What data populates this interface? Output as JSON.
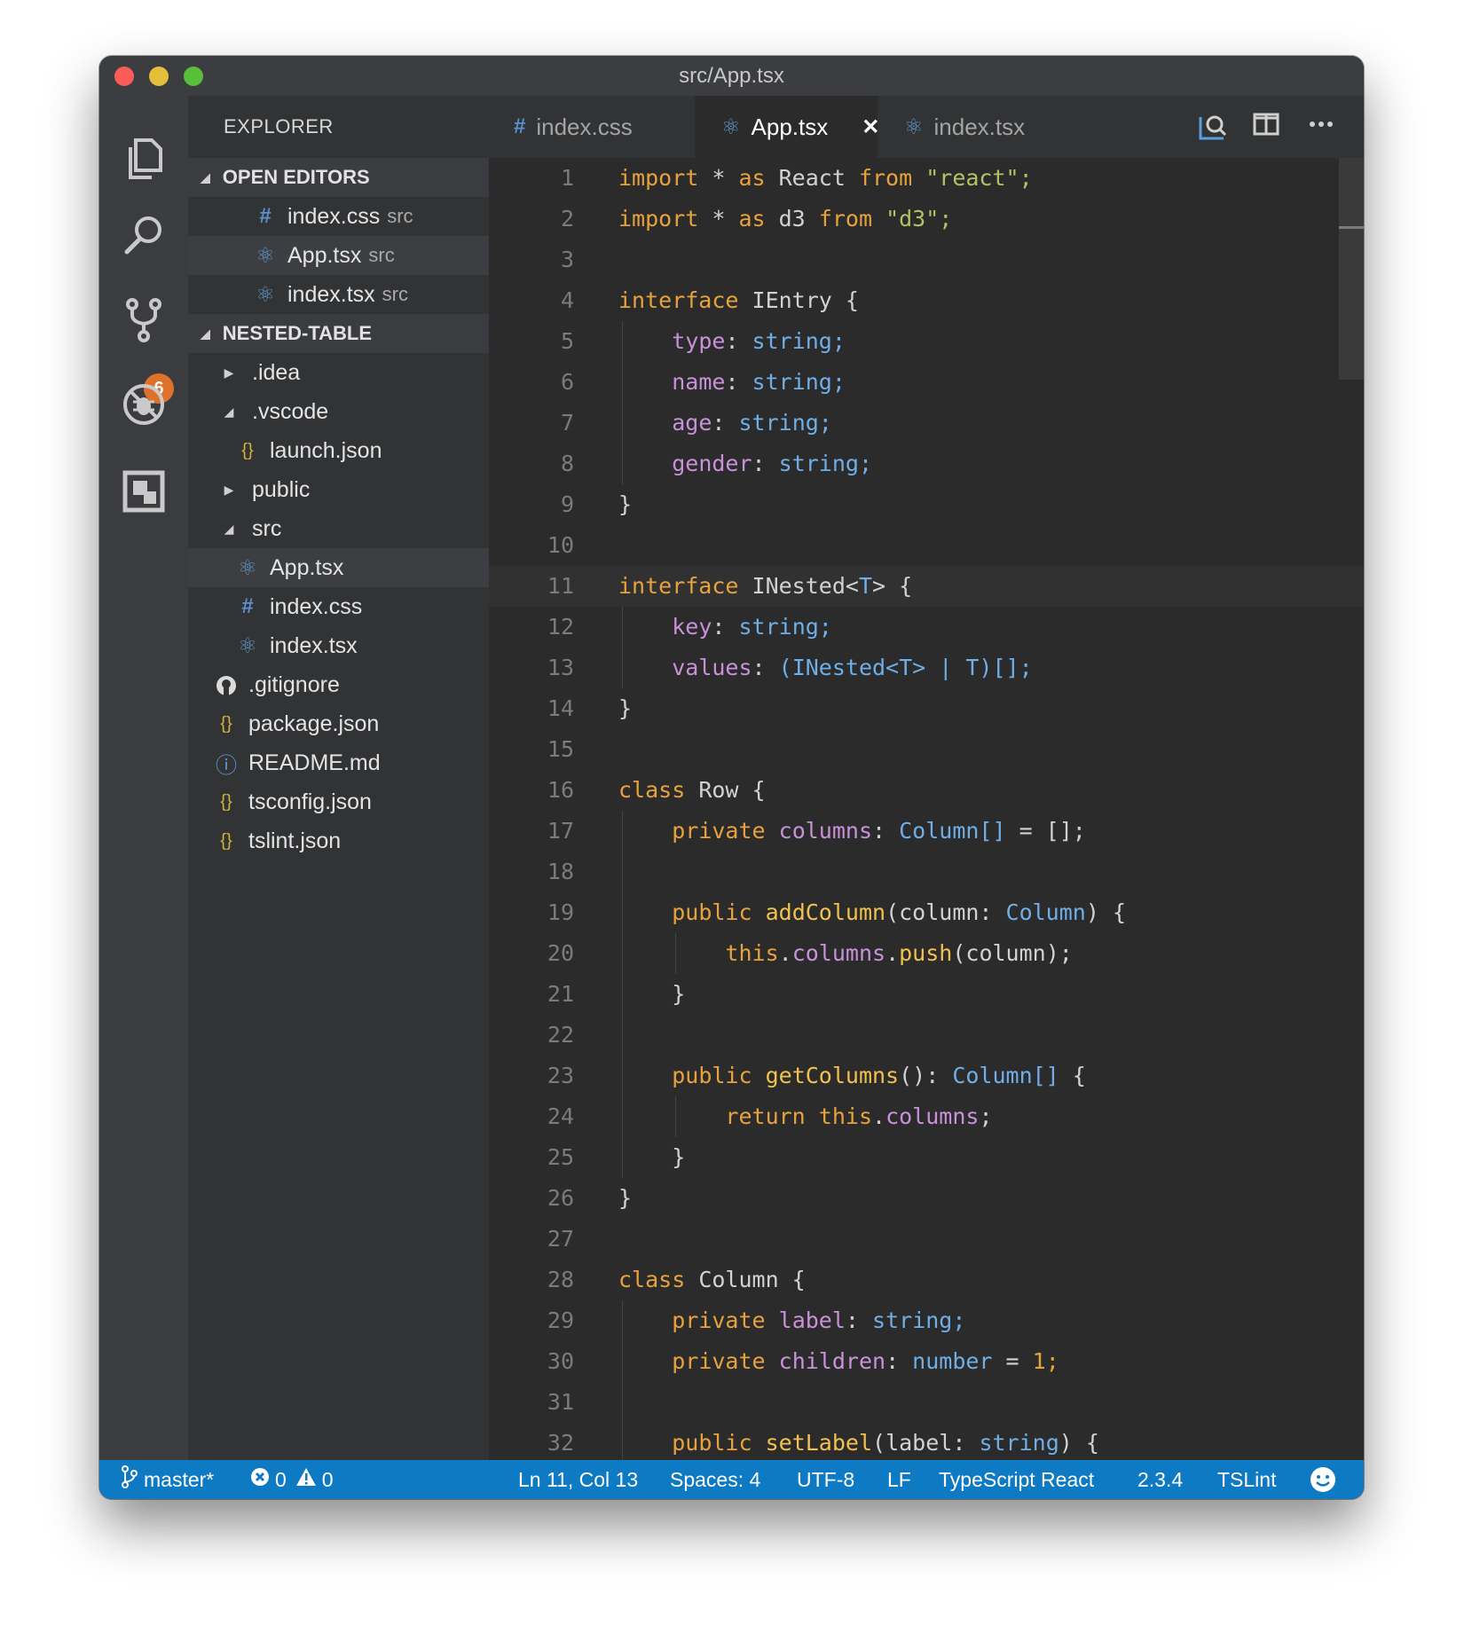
{
  "window": {
    "title": "src/App.tsx"
  },
  "activity": {
    "scm_badge": "6"
  },
  "sidebar": {
    "header": "EXPLORER",
    "open_editors": {
      "title": "OPEN EDITORS",
      "items": [
        {
          "icon": "#",
          "name": "index.css",
          "dir": "src",
          "type": "css"
        },
        {
          "icon": "⚛",
          "name": "App.tsx",
          "dir": "src",
          "type": "react"
        },
        {
          "icon": "⚛",
          "name": "index.tsx",
          "dir": "src",
          "type": "react"
        }
      ]
    },
    "project": {
      "title": "NESTED-TABLE",
      "items": [
        {
          "name": ".idea",
          "kind": "folder-closed"
        },
        {
          "name": ".vscode",
          "kind": "folder-open"
        },
        {
          "name": "launch.json",
          "icon": "{}"
        },
        {
          "name": "public",
          "kind": "folder-closed"
        },
        {
          "name": "src",
          "kind": "folder-open"
        },
        {
          "name": "App.tsx",
          "icon": "⚛"
        },
        {
          "name": "index.css",
          "icon": "#"
        },
        {
          "name": "index.tsx",
          "icon": "⚛"
        },
        {
          "name": ".gitignore"
        },
        {
          "name": "package.json",
          "icon": "{}"
        },
        {
          "name": "README.md",
          "icon": "ⓘ"
        },
        {
          "name": "tsconfig.json",
          "icon": "{}"
        },
        {
          "name": "tslint.json",
          "icon": "{}"
        }
      ]
    }
  },
  "tabs": [
    {
      "icon": "#",
      "label": "index.css"
    },
    {
      "icon": "⚛",
      "label": "App.tsx",
      "close": "✕"
    },
    {
      "icon": "⚛",
      "label": "index.tsx"
    }
  ],
  "editor": {
    "current_line": 11,
    "lines": [
      {
        "n": "1",
        "tokens": [
          [
            "k",
            "import"
          ],
          [
            "w",
            " * "
          ],
          [
            "k",
            "as"
          ],
          [
            "w",
            " React "
          ],
          [
            "k",
            "from"
          ],
          [
            "w",
            " "
          ],
          [
            "s",
            "\"react\""
          ],
          [
            "s",
            ";"
          ]
        ]
      },
      {
        "n": "2",
        "tokens": [
          [
            "k",
            "import"
          ],
          [
            "w",
            " * "
          ],
          [
            "k",
            "as"
          ],
          [
            "w",
            " d3 "
          ],
          [
            "k",
            "from"
          ],
          [
            "w",
            " "
          ],
          [
            "s",
            "\"d3\""
          ],
          [
            "s",
            ";"
          ]
        ]
      },
      {
        "n": "3",
        "tokens": []
      },
      {
        "n": "4",
        "tokens": [
          [
            "k",
            "interface"
          ],
          [
            "w",
            " IEntry {"
          ]
        ]
      },
      {
        "n": "5",
        "tokens": [
          [
            "w",
            "    "
          ],
          [
            "p",
            "type"
          ],
          [
            "w",
            ": "
          ],
          [
            "t",
            "string;"
          ]
        ]
      },
      {
        "n": "6",
        "tokens": [
          [
            "w",
            "    "
          ],
          [
            "p",
            "name"
          ],
          [
            "w",
            ": "
          ],
          [
            "t",
            "string;"
          ]
        ]
      },
      {
        "n": "7",
        "tokens": [
          [
            "w",
            "    "
          ],
          [
            "p",
            "age"
          ],
          [
            "w",
            ": "
          ],
          [
            "t",
            "string;"
          ]
        ]
      },
      {
        "n": "8",
        "tokens": [
          [
            "w",
            "    "
          ],
          [
            "p",
            "gender"
          ],
          [
            "w",
            ": "
          ],
          [
            "t",
            "string;"
          ]
        ]
      },
      {
        "n": "9",
        "tokens": [
          [
            "w",
            "}"
          ]
        ]
      },
      {
        "n": "10",
        "tokens": []
      },
      {
        "n": "11",
        "tokens": [
          [
            "k",
            "interface"
          ],
          [
            "w",
            " INested<"
          ],
          [
            "t",
            "T"
          ],
          [
            "w",
            "> {"
          ]
        ]
      },
      {
        "n": "12",
        "tokens": [
          [
            "w",
            "    "
          ],
          [
            "p",
            "key"
          ],
          [
            "w",
            ": "
          ],
          [
            "t",
            "string;"
          ]
        ]
      },
      {
        "n": "13",
        "tokens": [
          [
            "w",
            "    "
          ],
          [
            "p",
            "values"
          ],
          [
            "w",
            ": "
          ],
          [
            "t",
            "(INested<T> | T)[];"
          ]
        ]
      },
      {
        "n": "14",
        "tokens": [
          [
            "w",
            "}"
          ]
        ]
      },
      {
        "n": "15",
        "tokens": []
      },
      {
        "n": "16",
        "tokens": [
          [
            "k",
            "class"
          ],
          [
            "w",
            " Row {"
          ]
        ]
      },
      {
        "n": "17",
        "tokens": [
          [
            "w",
            "    "
          ],
          [
            "k",
            "private"
          ],
          [
            "w",
            " "
          ],
          [
            "p",
            "columns"
          ],
          [
            "w",
            ": "
          ],
          [
            "t",
            "Column[]"
          ],
          [
            "w",
            " = [];"
          ]
        ]
      },
      {
        "n": "18",
        "tokens": []
      },
      {
        "n": "19",
        "tokens": [
          [
            "w",
            "    "
          ],
          [
            "k",
            "public"
          ],
          [
            "w",
            " "
          ],
          [
            "f",
            "addColumn"
          ],
          [
            "w",
            "(column: "
          ],
          [
            "t",
            "Column"
          ],
          [
            "w",
            ") {"
          ]
        ]
      },
      {
        "n": "20",
        "tokens": [
          [
            "w",
            "        "
          ],
          [
            "k",
            "this"
          ],
          [
            "w",
            "."
          ],
          [
            "p",
            "columns"
          ],
          [
            "w",
            "."
          ],
          [
            "f",
            "push"
          ],
          [
            "w",
            "(column);"
          ]
        ]
      },
      {
        "n": "21",
        "tokens": [
          [
            "w",
            "    }"
          ]
        ]
      },
      {
        "n": "22",
        "tokens": []
      },
      {
        "n": "23",
        "tokens": [
          [
            "w",
            "    "
          ],
          [
            "k",
            "public"
          ],
          [
            "w",
            " "
          ],
          [
            "f",
            "getColumns"
          ],
          [
            "w",
            "(): "
          ],
          [
            "t",
            "Column[]"
          ],
          [
            "w",
            " {"
          ]
        ]
      },
      {
        "n": "24",
        "tokens": [
          [
            "w",
            "        "
          ],
          [
            "k",
            "return"
          ],
          [
            "w",
            " "
          ],
          [
            "k",
            "this"
          ],
          [
            "w",
            "."
          ],
          [
            "p",
            "columns"
          ],
          [
            "w",
            ";"
          ]
        ]
      },
      {
        "n": "25",
        "tokens": [
          [
            "w",
            "    }"
          ]
        ]
      },
      {
        "n": "26",
        "tokens": [
          [
            "w",
            "}"
          ]
        ]
      },
      {
        "n": "27",
        "tokens": []
      },
      {
        "n": "28",
        "tokens": [
          [
            "k",
            "class"
          ],
          [
            "w",
            " Column {"
          ]
        ]
      },
      {
        "n": "29",
        "tokens": [
          [
            "w",
            "    "
          ],
          [
            "k",
            "private"
          ],
          [
            "w",
            " "
          ],
          [
            "p",
            "label"
          ],
          [
            "w",
            ": "
          ],
          [
            "t",
            "string;"
          ]
        ]
      },
      {
        "n": "30",
        "tokens": [
          [
            "w",
            "    "
          ],
          [
            "k",
            "private"
          ],
          [
            "w",
            " "
          ],
          [
            "p",
            "children"
          ],
          [
            "w",
            ": "
          ],
          [
            "t",
            "number"
          ],
          [
            "w",
            " = "
          ],
          [
            "n",
            "1;"
          ]
        ]
      },
      {
        "n": "31",
        "tokens": []
      },
      {
        "n": "32",
        "tokens": [
          [
            "w",
            "    "
          ],
          [
            "k",
            "public"
          ],
          [
            "w",
            " "
          ],
          [
            "f",
            "setLabel"
          ],
          [
            "w",
            "(label: "
          ],
          [
            "t",
            "string"
          ],
          [
            "w",
            ") {"
          ]
        ]
      }
    ]
  },
  "status": {
    "branch": "master*",
    "errors": "0",
    "warnings": "0",
    "position": "Ln 11, Col 13",
    "spaces": "Spaces: 4",
    "encoding": "UTF-8",
    "eol": "LF",
    "language": "TypeScript React",
    "version": "2.3.4",
    "linter": "TSLint"
  },
  "colors": {
    "accent": "#0e7ac4",
    "badge": "#e0712a",
    "keyword": "#e8a23c",
    "string": "#b3c262",
    "property": "#c991d9",
    "type": "#6faee6",
    "function": "#f2c14e"
  }
}
